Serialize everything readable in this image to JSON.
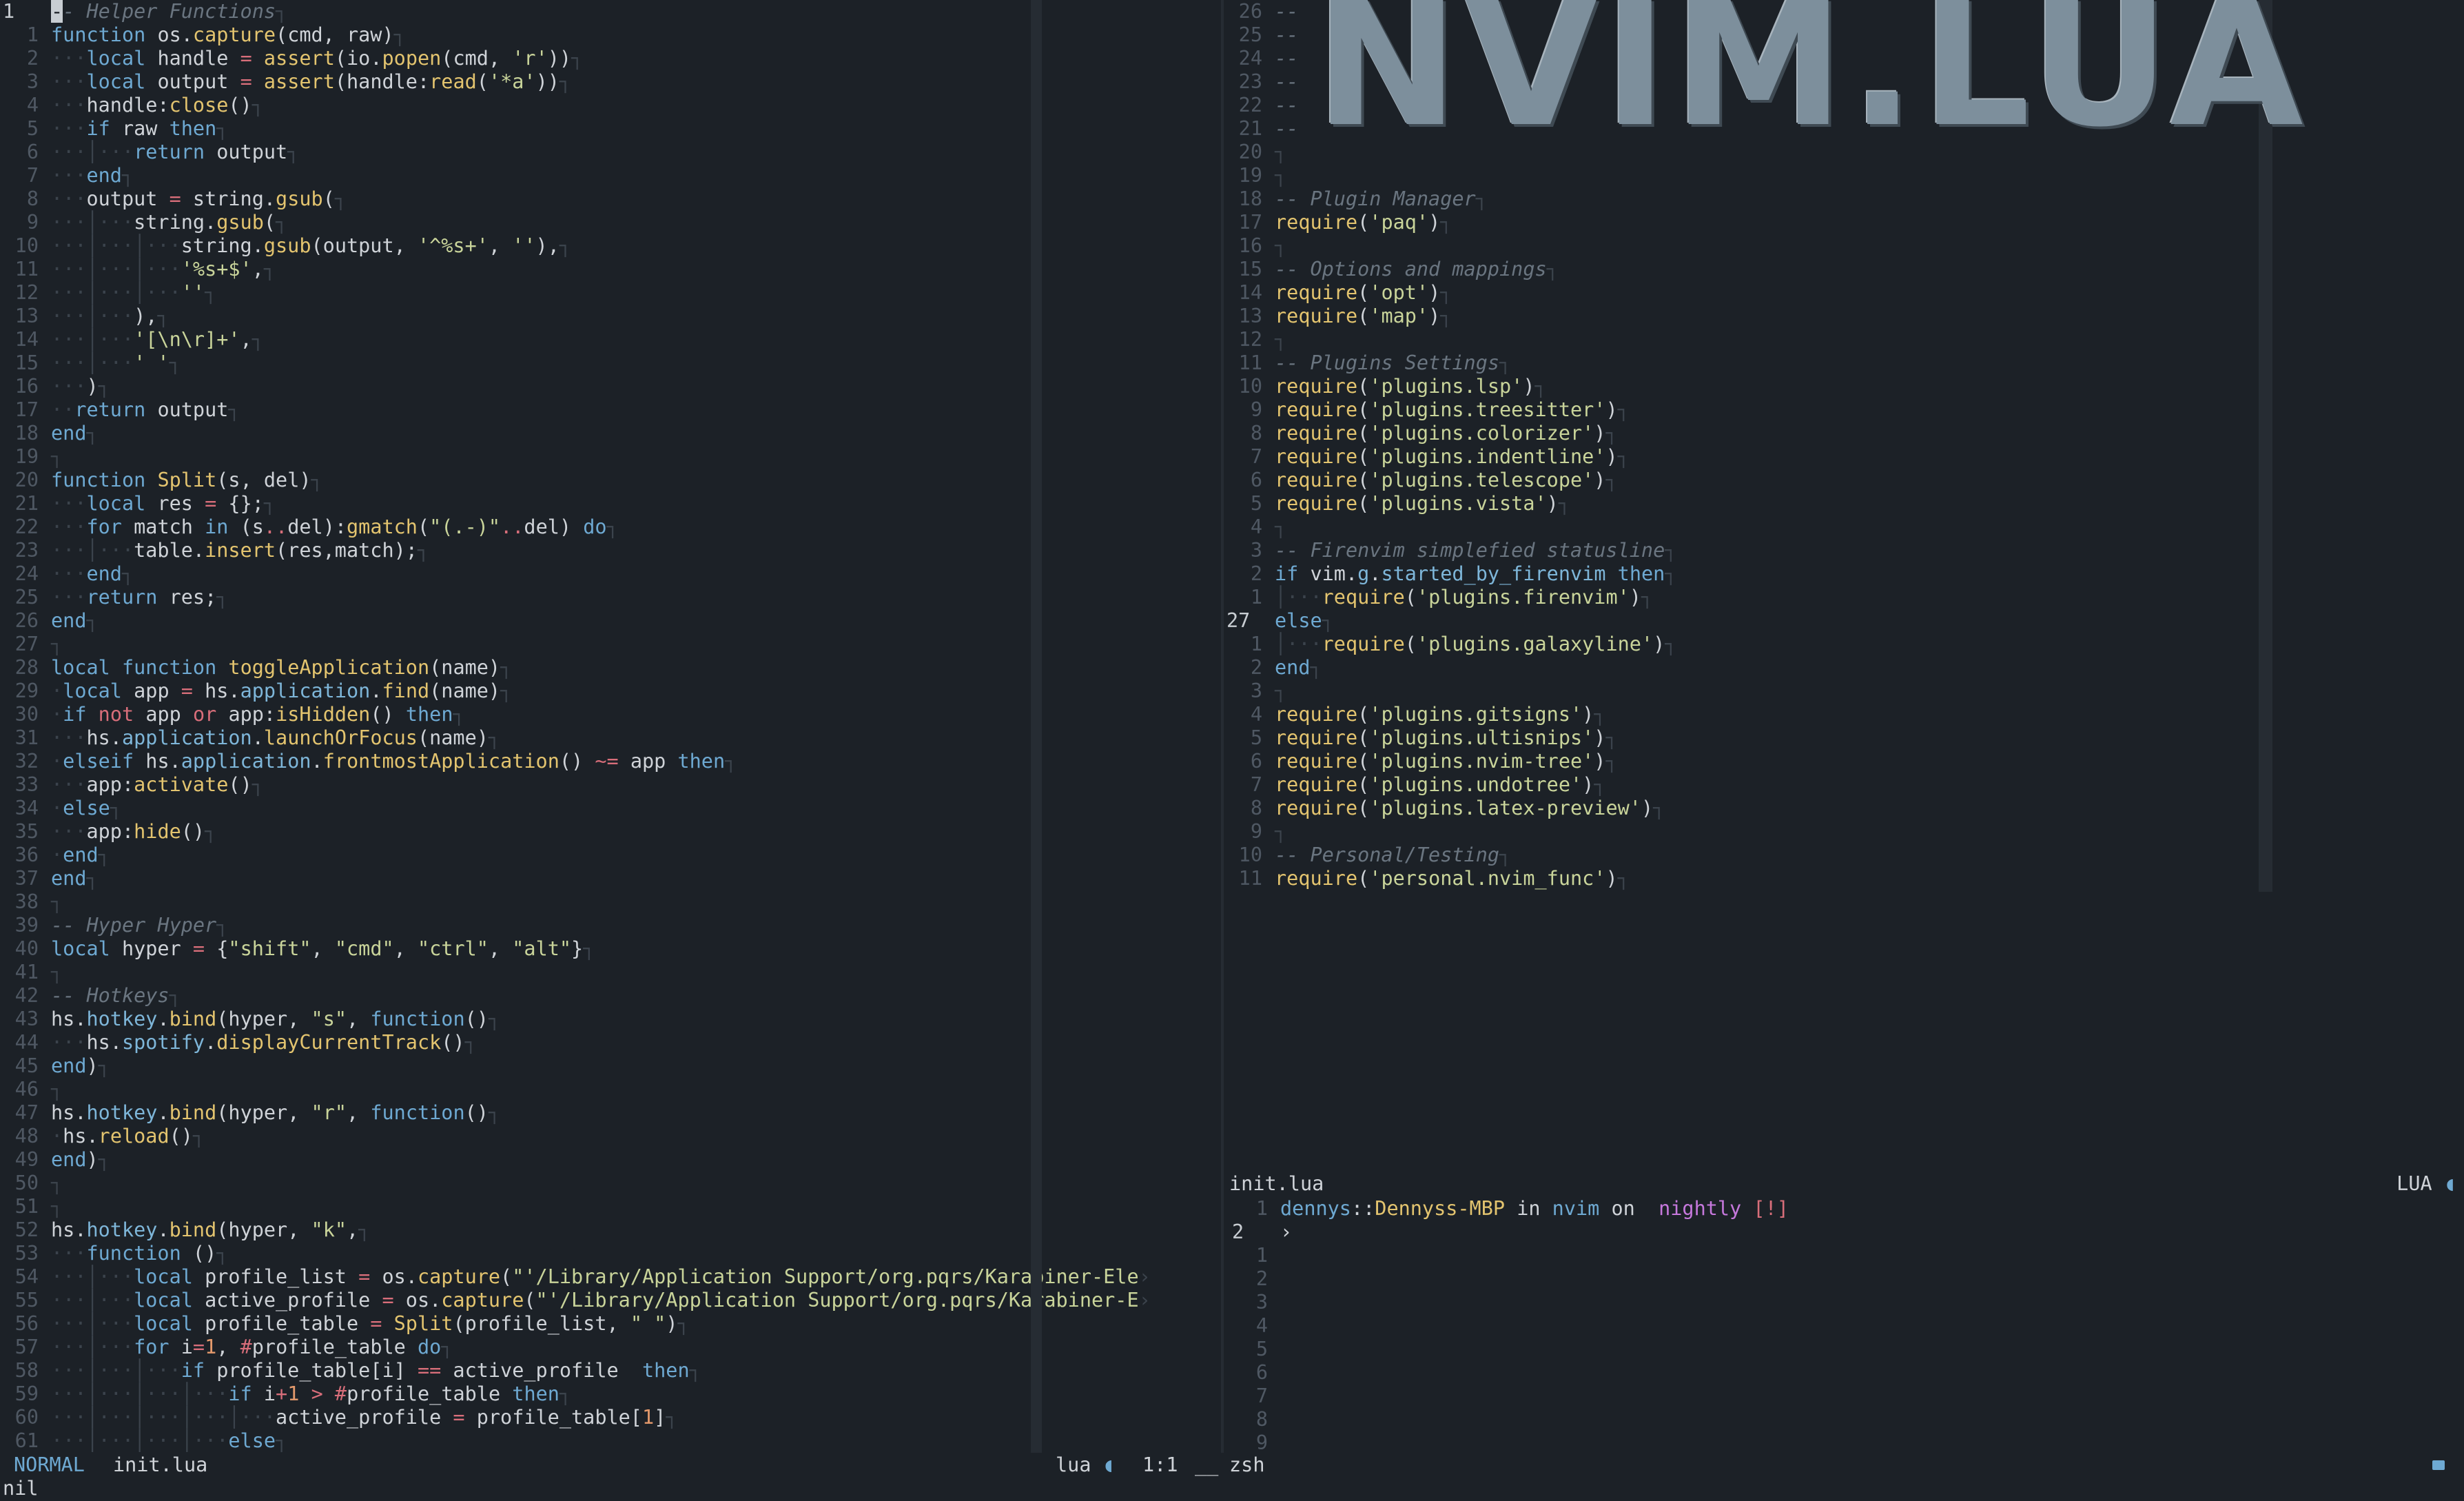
{
  "left_editor": {
    "lines": [
      {
        "n": "1",
        "cur": true,
        "html": "<span class=\"cursor\">-</span><span class=\"cm\">- Helper Functions</span><span class=\"eol\">┐</span>"
      },
      {
        "n": "1",
        "html": "<span class=\"kw\">function</span> os.<span class=\"fn\">capture</span>(cmd, raw)<span class=\"eol\">┐</span>"
      },
      {
        "n": "2",
        "html": "<span class=\"ws\">···</span><span class=\"kw\">local</span> handle <span class=\"op\">=</span> <span class=\"fn\">assert</span>(io.<span class=\"fn\">popen</span>(cmd, <span class=\"str\">'r'</span>))<span class=\"eol\">┐</span>"
      },
      {
        "n": "3",
        "html": "<span class=\"ws\">···</span><span class=\"kw\">local</span> output <span class=\"op\">=</span> <span class=\"fn\">assert</span>(handle:<span class=\"fn\">read</span>(<span class=\"str\">'*a'</span>))<span class=\"eol\">┐</span>"
      },
      {
        "n": "4",
        "html": "<span class=\"ws\">···</span>handle:<span class=\"fn\">close</span>()<span class=\"eol\">┐</span>"
      },
      {
        "n": "5",
        "html": "<span class=\"ws\">···</span><span class=\"kw\">if</span> raw <span class=\"kw\">then</span><span class=\"eol\">┐</span>"
      },
      {
        "n": "6",
        "html": "<span class=\"ws\">···│···</span><span class=\"kw\">return</span> output<span class=\"eol\">┐</span>"
      },
      {
        "n": "7",
        "html": "<span class=\"ws\">···</span><span class=\"kw\">end</span><span class=\"eol\">┐</span>"
      },
      {
        "n": "8",
        "html": "<span class=\"ws\">···</span>output <span class=\"op\">=</span> string.<span class=\"fn\">gsub</span>(<span class=\"eol\">┐</span>"
      },
      {
        "n": "9",
        "html": "<span class=\"ws\">···│···</span>string.<span class=\"fn\">gsub</span>(<span class=\"eol\">┐</span>"
      },
      {
        "n": "10",
        "html": "<span class=\"ws\">···│···│···</span>string.<span class=\"fn\">gsub</span>(output, <span class=\"str\">'^%s+'</span>, <span class=\"str\">''</span>),<span class=\"eol\">┐</span>"
      },
      {
        "n": "11",
        "html": "<span class=\"ws\">···│···│···</span><span class=\"str\">'%s+$'</span>,<span class=\"eol\">┐</span>"
      },
      {
        "n": "12",
        "html": "<span class=\"ws\">···│···│···</span><span class=\"str\">''</span><span class=\"eol\">┐</span>"
      },
      {
        "n": "13",
        "html": "<span class=\"ws\">···│···</span>),<span class=\"eol\">┐</span>"
      },
      {
        "n": "14",
        "html": "<span class=\"ws\">···│···</span><span class=\"str\">'[\\n\\r]+'</span>,<span class=\"eol\">┐</span>"
      },
      {
        "n": "15",
        "html": "<span class=\"ws\">···│···</span><span class=\"str\">' '</span><span class=\"eol\">┐</span>"
      },
      {
        "n": "16",
        "html": "<span class=\"ws\">···</span>)<span class=\"eol\">┐</span>"
      },
      {
        "n": "17",
        "html": "<span class=\"ws\">··</span><span class=\"kw\">return</span> output<span class=\"eol\">┐</span>"
      },
      {
        "n": "18",
        "html": "<span class=\"kw\">end</span><span class=\"eol\">┐</span>"
      },
      {
        "n": "19",
        "html": "<span class=\"eol\">┐</span>"
      },
      {
        "n": "20",
        "html": "<span class=\"kw\">function</span> <span class=\"fn\">Split</span>(s, del)<span class=\"eol\">┐</span>"
      },
      {
        "n": "21",
        "html": "<span class=\"ws\">···</span><span class=\"kw\">local</span> res <span class=\"op\">=</span> {};<span class=\"eol\">┐</span>"
      },
      {
        "n": "22",
        "html": "<span class=\"ws\">···</span><span class=\"kw\">for</span> match <span class=\"kw\">in</span> (s<span class=\"op\">..</span>del):<span class=\"fn\">gmatch</span>(<span class=\"str\">\"(.-)\"</span><span class=\"op\">..</span>del) <span class=\"kw\">do</span><span class=\"eol\">┐</span>"
      },
      {
        "n": "23",
        "html": "<span class=\"ws\">···│···</span>table.<span class=\"fn\">insert</span>(res,match);<span class=\"eol\">┐</span>"
      },
      {
        "n": "24",
        "html": "<span class=\"ws\">···</span><span class=\"kw\">end</span><span class=\"eol\">┐</span>"
      },
      {
        "n": "25",
        "html": "<span class=\"ws\">···</span><span class=\"kw\">return</span> res;<span class=\"eol\">┐</span>"
      },
      {
        "n": "26",
        "html": "<span class=\"kw\">end</span><span class=\"eol\">┐</span>"
      },
      {
        "n": "27",
        "html": "<span class=\"eol\">┐</span>"
      },
      {
        "n": "28",
        "html": "<span class=\"kw\">local</span> <span class=\"kw\">function</span> <span class=\"fn\">toggleApplication</span>(name)<span class=\"eol\">┐</span>"
      },
      {
        "n": "29",
        "html": "<span class=\"ws\">·</span><span class=\"kw\">local</span> app <span class=\"op\">=</span> hs.<span class=\"field\">application</span>.<span class=\"fn\">find</span>(name)<span class=\"eol\">┐</span>"
      },
      {
        "n": "30",
        "html": "<span class=\"ws\">·</span><span class=\"kw\">if</span> <span class=\"op\">not</span> app <span class=\"op\">or</span> app:<span class=\"fn\">isHidden</span>() <span class=\"kw\">then</span><span class=\"eol\">┐</span>"
      },
      {
        "n": "31",
        "html": "<span class=\"ws\">···</span>hs.<span class=\"field\">application</span>.<span class=\"fn\">launchOrFocus</span>(name)<span class=\"eol\">┐</span>"
      },
      {
        "n": "32",
        "html": "<span class=\"ws\">·</span><span class=\"kw\">elseif</span> hs.<span class=\"field\">application</span>.<span class=\"fn\">frontmostApplication</span>() <span class=\"op\">~=</span> app <span class=\"kw\">then</span><span class=\"eol\">┐</span>"
      },
      {
        "n": "33",
        "html": "<span class=\"ws\">···</span>app:<span class=\"fn\">activate</span>()<span class=\"eol\">┐</span>"
      },
      {
        "n": "34",
        "html": "<span class=\"ws\">·</span><span class=\"kw\">else</span><span class=\"eol\">┐</span>"
      },
      {
        "n": "35",
        "html": "<span class=\"ws\">···</span>app:<span class=\"fn\">hide</span>()<span class=\"eol\">┐</span>"
      },
      {
        "n": "36",
        "html": "<span class=\"ws\">·</span><span class=\"kw\">end</span><span class=\"eol\">┐</span>"
      },
      {
        "n": "37",
        "html": "<span class=\"kw\">end</span><span class=\"eol\">┐</span>"
      },
      {
        "n": "38",
        "html": "<span class=\"eol\">┐</span>"
      },
      {
        "n": "39",
        "html": "<span class=\"cm\">-- Hyper Hyper</span><span class=\"eol\">┐</span>"
      },
      {
        "n": "40",
        "html": "<span class=\"kw\">local</span> hyper <span class=\"op\">=</span> {<span class=\"str\">\"shift\"</span>, <span class=\"str\">\"cmd\"</span>, <span class=\"str\">\"ctrl\"</span>, <span class=\"str\">\"alt\"</span>}<span class=\"eol\">┐</span>"
      },
      {
        "n": "41",
        "html": "<span class=\"eol\">┐</span>"
      },
      {
        "n": "42",
        "html": "<span class=\"cm\">-- Hotkeys</span><span class=\"eol\">┐</span>"
      },
      {
        "n": "43",
        "html": "hs.<span class=\"field\">hotkey</span>.<span class=\"fn\">bind</span>(hyper, <span class=\"str\">\"s\"</span>, <span class=\"kw\">function</span>()<span class=\"eol\">┐</span>"
      },
      {
        "n": "44",
        "html": "<span class=\"ws\">···</span>hs.<span class=\"field\">spotify</span>.<span class=\"fn\">displayCurrentTrack</span>()<span class=\"eol\">┐</span>"
      },
      {
        "n": "45",
        "html": "<span class=\"kw\">end</span>)<span class=\"eol\">┐</span>"
      },
      {
        "n": "46",
        "html": "<span class=\"eol\">┐</span>"
      },
      {
        "n": "47",
        "html": "hs.<span class=\"field\">hotkey</span>.<span class=\"fn\">bind</span>(hyper, <span class=\"str\">\"r\"</span>, <span class=\"kw\">function</span>()<span class=\"eol\">┐</span>"
      },
      {
        "n": "48",
        "html": "<span class=\"ws\">·</span>hs.<span class=\"fn\">reload</span>()<span class=\"eol\">┐</span>"
      },
      {
        "n": "49",
        "html": "<span class=\"kw\">end</span>)<span class=\"eol\">┐</span>"
      },
      {
        "n": "50",
        "html": "<span class=\"eol\">┐</span>"
      },
      {
        "n": "51",
        "html": "<span class=\"eol\">┐</span>"
      },
      {
        "n": "52",
        "html": "hs.<span class=\"field\">hotkey</span>.<span class=\"fn\">bind</span>(hyper, <span class=\"str\">\"k\"</span>,<span class=\"eol\">┐</span>"
      },
      {
        "n": "53",
        "html": "<span class=\"ws\">···</span><span class=\"kw\">function</span> ()<span class=\"eol\">┐</span>"
      },
      {
        "n": "54",
        "html": "<span class=\"ws\">···│···</span><span class=\"kw\">local</span> profile_list <span class=\"op\">=</span> os.<span class=\"fn\">capture</span>(<span class=\"str\">\"'/Library/Application Support/org.pqrs/Karabiner-Ele</span><span class=\"eol\">›</span>"
      },
      {
        "n": "55",
        "html": "<span class=\"ws\">···│···</span><span class=\"kw\">local</span> active_profile <span class=\"op\">=</span> os.<span class=\"fn\">capture</span>(<span class=\"str\">\"'/Library/Application Support/org.pqrs/Karabiner-E</span><span class=\"eol\">›</span>"
      },
      {
        "n": "56",
        "html": "<span class=\"ws\">···│···</span><span class=\"kw\">local</span> profile_table <span class=\"op\">=</span> <span class=\"fn\">Split</span>(profile_list, <span class=\"str\">\" \"</span>)<span class=\"eol\">┐</span>"
      },
      {
        "n": "57",
        "html": "<span class=\"ws\">···│···</span><span class=\"kw\">for</span> i<span class=\"op\">=</span><span class=\"num\">1</span>, <span class=\"op\">#</span>profile_table <span class=\"kw\">do</span><span class=\"eol\">┐</span>"
      },
      {
        "n": "58",
        "html": "<span class=\"ws\">···│···│···</span><span class=\"kw\">if</span> profile_table[i] <span class=\"op\">==</span> active_profile  <span class=\"kw\">then</span><span class=\"eol\">┐</span>"
      },
      {
        "n": "59",
        "html": "<span class=\"ws\">···│···│···│···</span><span class=\"kw\">if</span> i<span class=\"op\">+</span><span class=\"num\">1</span> <span class=\"op\">&gt;</span> <span class=\"op\">#</span>profile_table <span class=\"kw\">then</span><span class=\"eol\">┐</span>"
      },
      {
        "n": "60",
        "html": "<span class=\"ws\">···│···│···│···│···</span>active_profile <span class=\"op\">=</span> profile_table[<span class=\"num\">1</span>]<span class=\"eol\">┐</span>"
      },
      {
        "n": "61",
        "html": "<span class=\"ws\">···│···│···│···</span><span class=\"kw\">else</span><span class=\"eol\">┐</span>"
      }
    ]
  },
  "right_editor": {
    "banner": "NVIM.LUA",
    "lines": [
      {
        "n": "26",
        "html": "<span class=\"cm\">--</span>"
      },
      {
        "n": "25",
        "html": "<span class=\"cm\">--</span>"
      },
      {
        "n": "24",
        "html": "<span class=\"cm\">--</span>"
      },
      {
        "n": "23",
        "html": "<span class=\"cm\">--</span>"
      },
      {
        "n": "22",
        "html": "<span class=\"cm\">--</span>"
      },
      {
        "n": "21",
        "html": "<span class=\"cm\">--</span>"
      },
      {
        "n": "20",
        "html": "<span class=\"eol\">┐</span>"
      },
      {
        "n": "19",
        "html": "<span class=\"eol\">┐</span>"
      },
      {
        "n": "18",
        "html": "<span class=\"cm\">-- Plugin Manager</span><span class=\"eol\">┐</span>"
      },
      {
        "n": "17",
        "html": "<span class=\"fn\">require</span>(<span class=\"str\">'paq'</span>)<span class=\"eol\">┐</span>"
      },
      {
        "n": "16",
        "html": "<span class=\"eol\">┐</span>"
      },
      {
        "n": "15",
        "html": "<span class=\"cm\">-- Options and mappings</span><span class=\"eol\">┐</span>"
      },
      {
        "n": "14",
        "html": "<span class=\"fn\">require</span>(<span class=\"str\">'opt'</span>)<span class=\"eol\">┐</span>"
      },
      {
        "n": "13",
        "html": "<span class=\"fn\">require</span>(<span class=\"str\">'map'</span>)<span class=\"eol\">┐</span>"
      },
      {
        "n": "12",
        "html": "<span class=\"eol\">┐</span>"
      },
      {
        "n": "11",
        "html": "<span class=\"cm\">-- Plugins Settings</span><span class=\"eol\">┐</span>"
      },
      {
        "n": "10",
        "html": "<span class=\"fn\">require</span>(<span class=\"str\">'plugins.lsp'</span>)<span class=\"eol\">┐</span>"
      },
      {
        "n": "9",
        "html": "<span class=\"fn\">require</span>(<span class=\"str\">'plugins.treesitter'</span>)<span class=\"eol\">┐</span>"
      },
      {
        "n": "8",
        "html": "<span class=\"fn\">require</span>(<span class=\"str\">'plugins.colorizer'</span>)<span class=\"eol\">┐</span>"
      },
      {
        "n": "7",
        "html": "<span class=\"fn\">require</span>(<span class=\"str\">'plugins.indentline'</span>)<span class=\"eol\">┐</span>"
      },
      {
        "n": "6",
        "html": "<span class=\"fn\">require</span>(<span class=\"str\">'plugins.telescope'</span>)<span class=\"eol\">┐</span>"
      },
      {
        "n": "5",
        "html": "<span class=\"fn\">require</span>(<span class=\"str\">'plugins.vista'</span>)<span class=\"eol\">┐</span>"
      },
      {
        "n": "4",
        "html": "<span class=\"eol\">┐</span>"
      },
      {
        "n": "3",
        "html": "<span class=\"cm\">-- Firenvim simplefied statusline</span><span class=\"eol\">┐</span>"
      },
      {
        "n": "2",
        "html": "<span class=\"kw\">if</span> vim.<span class=\"field\">g</span>.<span class=\"field\">started_by_firenvim</span> <span class=\"kw\">then</span><span class=\"eol\">┐</span>"
      },
      {
        "n": "1",
        "html": "<span class=\"ws\">│···</span><span class=\"fn\">require</span>(<span class=\"str\">'plugins.firenvim'</span>)<span class=\"eol\">┐</span>"
      },
      {
        "n": "27",
        "cur": true,
        "html": "<span class=\"kw\">else</span><span class=\"eol\">┐</span>"
      },
      {
        "n": "1",
        "html": "<span class=\"ws\">│···</span><span class=\"fn\">require</span>(<span class=\"str\">'plugins.galaxyline'</span>)<span class=\"eol\">┐</span>"
      },
      {
        "n": "2",
        "html": "<span class=\"kw\">end</span><span class=\"eol\">┐</span>"
      },
      {
        "n": "3",
        "html": "<span class=\"eol\">┐</span>"
      },
      {
        "n": "4",
        "html": "<span class=\"fn\">require</span>(<span class=\"str\">'plugins.gitsigns'</span>)<span class=\"eol\">┐</span>"
      },
      {
        "n": "5",
        "html": "<span class=\"fn\">require</span>(<span class=\"str\">'plugins.ultisnips'</span>)<span class=\"eol\">┐</span>"
      },
      {
        "n": "6",
        "html": "<span class=\"fn\">require</span>(<span class=\"str\">'plugins.nvim-tree'</span>)<span class=\"eol\">┐</span>"
      },
      {
        "n": "7",
        "html": "<span class=\"fn\">require</span>(<span class=\"str\">'plugins.undotree'</span>)<span class=\"eol\">┐</span>"
      },
      {
        "n": "8",
        "html": "<span class=\"fn\">require</span>(<span class=\"str\">'plugins.latex-preview'</span>)<span class=\"eol\">┐</span>"
      },
      {
        "n": "9",
        "html": "<span class=\"eol\">┐</span>"
      },
      {
        "n": "10",
        "html": "<span class=\"cm\">-- Personal/Testing</span><span class=\"eol\">┐</span>"
      },
      {
        "n": "11",
        "html": "<span class=\"fn\">require</span>(<span class=\"str\">'personal.nvim_func'</span>)<span class=\"eol\">┐</span>"
      }
    ]
  },
  "winbar": {
    "filename": "init.lua",
    "filetype": "LUA"
  },
  "terminal": {
    "prompt": {
      "user": "dennys",
      "sep": "::",
      "host": "Dennyss-MBP",
      "in": "in",
      "dir": "nvim",
      "on": "on",
      "branch": " nightly",
      "flag": "[!]"
    },
    "prompt_char": "›",
    "line_numbers": [
      "1",
      "2",
      "1",
      "2",
      "3",
      "4",
      "5",
      "6",
      "7",
      "8",
      "9"
    ]
  },
  "statusline": {
    "mode": "NORMAL",
    "filename": "init.lua",
    "filetype": "lua",
    "position": "1:1",
    "sep": "__",
    "shell": "zsh"
  },
  "cmdline": "nil",
  "colors": {
    "bg": "#1c2127",
    "keyword": "#6ea9d2",
    "function": "#e3c46f",
    "string": "#c9d49a",
    "comment": "#6a7580"
  }
}
